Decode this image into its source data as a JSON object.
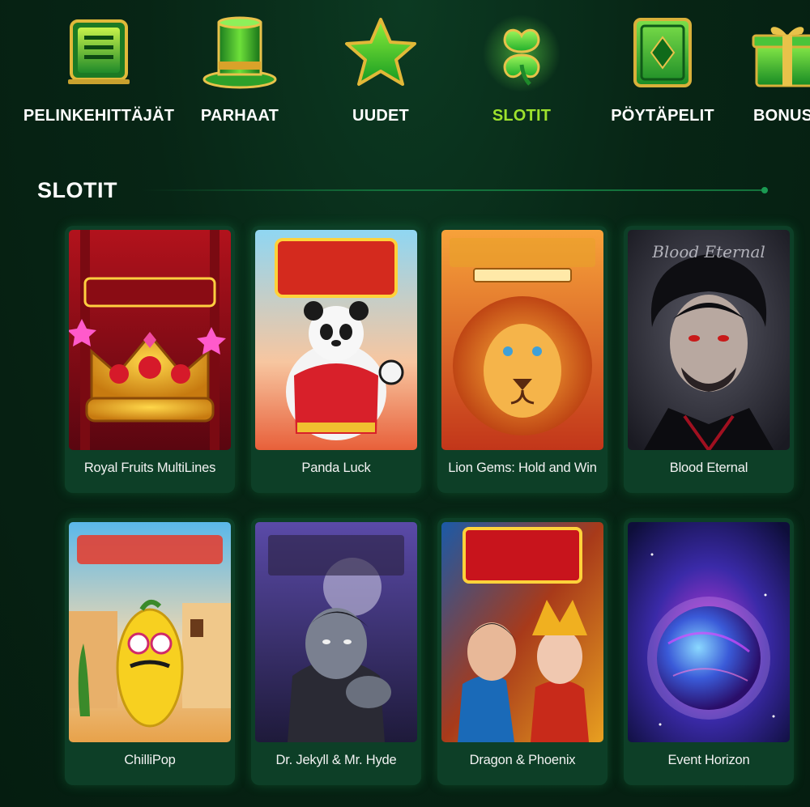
{
  "nav": {
    "items": [
      {
        "label": "PELINKEHITTÄJÄT",
        "icon": "monitor-icon",
        "active": false
      },
      {
        "label": "PARHAAT",
        "icon": "top-hat-icon",
        "active": false
      },
      {
        "label": "UUDET",
        "icon": "star-icon",
        "active": false
      },
      {
        "label": "SLOTIT",
        "icon": "clover-icon",
        "active": true
      },
      {
        "label": "PÖYTÄPELIT",
        "icon": "card-icon",
        "active": false
      },
      {
        "label": "BONUS",
        "icon": "gift-icon",
        "active": false
      }
    ]
  },
  "section": {
    "title": "SLOTIT"
  },
  "games": [
    {
      "name": "Royal Fruits MultiLines",
      "art": "Royal Fruits MultiLines"
    },
    {
      "name": "Panda Luck",
      "art": "Panda Luck"
    },
    {
      "name": "Lion Gems: Hold and Win",
      "art": "Lion Gems Hold and Win"
    },
    {
      "name": "Blood Eternal",
      "art": "Blood Eternal"
    },
    {
      "name": "ChilliPop",
      "art": "ChilliPop"
    },
    {
      "name": "Dr. Jekyll & Mr. Hyde",
      "art": "Dr. Jekyll & Mr. Hyde"
    },
    {
      "name": "Dragon & Phoenix",
      "art": "Dragon & Phoenix"
    },
    {
      "name": "Event Horizon",
      "art": "Event Horizon"
    }
  ],
  "colors": {
    "accent": "#9ee22d",
    "card_bg": "#0d3f27",
    "page_bg": "#072515"
  }
}
